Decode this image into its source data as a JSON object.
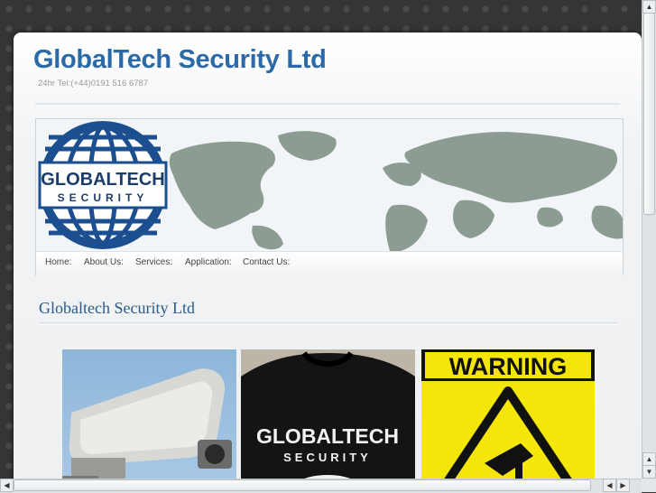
{
  "site": {
    "title": "GlobalTech Security Ltd",
    "telephone": "24hr Tel:(+44)0191 516 6787"
  },
  "banner": {
    "logo_line1": "GLOBALTECH",
    "logo_line2": "SECURITY"
  },
  "nav": {
    "items": [
      {
        "label": "Home:"
      },
      {
        "label": "About Us:"
      },
      {
        "label": "Services:"
      },
      {
        "label": "Application:"
      },
      {
        "label": "Contact Us:"
      }
    ]
  },
  "main": {
    "heading": "Globaltech Security Ltd",
    "gallery": {
      "shirt_line1": "GLOBALTECH",
      "shirt_line2": "SECURITY",
      "warning_text": "WARNING"
    }
  },
  "colors": {
    "title_blue": "#2b6aa6",
    "heading_blue": "#2a5b8f",
    "map_land": "#8c9c93",
    "warning_yellow": "#f5e60a"
  },
  "icons": {
    "scroll_up": "▲",
    "scroll_down": "▼",
    "scroll_left": "◀",
    "scroll_right": "▶"
  }
}
